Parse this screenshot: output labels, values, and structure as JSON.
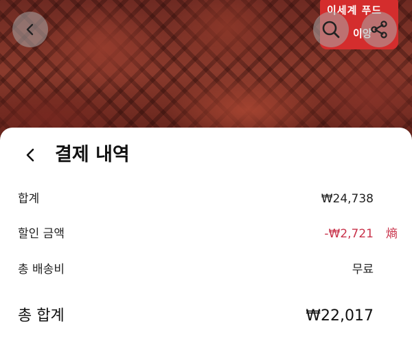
{
  "hero": {
    "sign_text": "이세계 푸드",
    "sign_sub": "이앙"
  },
  "top_bar": {
    "back_icon": "chevron-left-icon",
    "search_icon": "search-icon",
    "share_icon": "share-icon"
  },
  "payment": {
    "title": "결제 내역",
    "rows": [
      {
        "label": "합계",
        "value": "₩24,738"
      },
      {
        "label": "할인 금액",
        "value": "-₩2,721",
        "note": "熵"
      },
      {
        "label": "총 배송비",
        "value": "무료"
      }
    ],
    "total": {
      "label": "총 합계",
      "value": "₩22,017"
    }
  },
  "colors": {
    "discount": "#c8324a",
    "sign": "#d42d2d",
    "text": "#111111"
  }
}
